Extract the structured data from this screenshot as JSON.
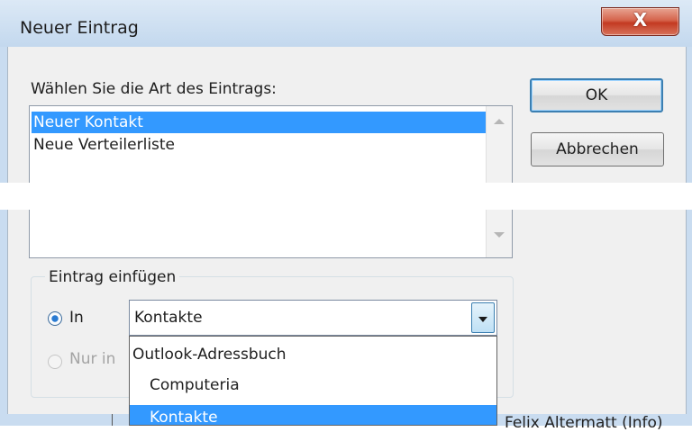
{
  "window": {
    "title": "Neuer Eintrag",
    "close_label": "X"
  },
  "prompt": "Wählen Sie die Art des Eintrags:",
  "entry_types": [
    {
      "label": "Neuer Kontakt",
      "selected": true
    },
    {
      "label": "Neue Verteilerliste",
      "selected": false
    }
  ],
  "buttons": {
    "ok": "OK",
    "cancel": "Abbrechen"
  },
  "insert_group": {
    "title": "Eintrag einfügen",
    "radio_in_label": "In",
    "radio_in_checked": true,
    "radio_only_label": "Nur in",
    "combo_value": "Kontakte",
    "dropdown_items": [
      {
        "label": "Outlook-Adressbuch",
        "indent": 0,
        "highlighted": false
      },
      {
        "label": "Computeria",
        "indent": 1,
        "highlighted": false
      },
      {
        "label": "Kontakte",
        "indent": 1,
        "highlighted": true
      }
    ]
  },
  "background_text": "Felix Altermatt (Info)",
  "colors": {
    "selection": "#3399ff",
    "title_bar": "#c9dcf0",
    "close_button": "#c33a22"
  }
}
